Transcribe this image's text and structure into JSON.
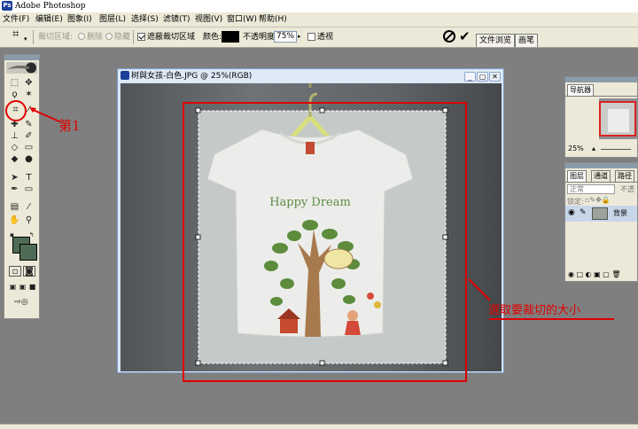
{
  "app": {
    "title": "Adobe Photoshop"
  },
  "menu": [
    "文件(F)",
    "编辑(E)",
    "图象(I)",
    "图层(L)",
    "选择(S)",
    "滤镜(T)",
    "视图(V)",
    "窗口(W)",
    "帮助(H)"
  ],
  "options": {
    "crop_area_label": "裁切区域:",
    "delete_label": "删除",
    "hide_label": "隐藏",
    "shield_label": "遮蔽裁切区域",
    "color_label": "颜色:",
    "opacity_label": "不透明度:",
    "opacity_value": "75%",
    "perspective_label": "透视",
    "shield_checked": true,
    "perspective_checked": false,
    "shield_color": "#000000"
  },
  "palette_well": {
    "tabs": [
      "文件浏览",
      "画笔"
    ]
  },
  "toolbox": {
    "fg_color": "#4e6b55",
    "bg_color": "#4e6b55"
  },
  "document": {
    "title": "树與女孩-白色.JPG @ 25%(RGB)"
  },
  "annotations": {
    "first_step": "第1",
    "select_size": "選取要裁切的大小"
  },
  "navigator": {
    "tab": "导航器",
    "zoom": "25%"
  },
  "layers": {
    "tabs": [
      "图层",
      "通道",
      "路径"
    ],
    "blend_mode": "正常",
    "opacity_short": "不透",
    "lock_label": "锁定:",
    "layer_name": "背景"
  },
  "tshirt": {
    "slogan": "Happy Dream"
  }
}
